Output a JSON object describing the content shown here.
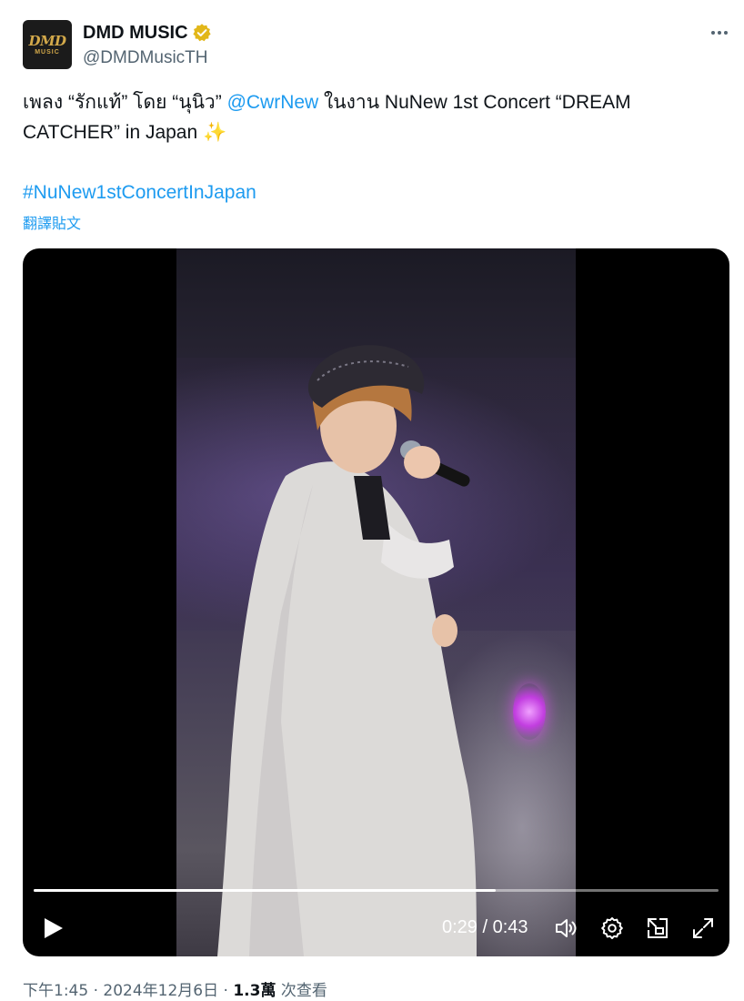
{
  "header": {
    "avatar_logo_main": "DMD",
    "avatar_logo_sub": "MUSIC",
    "display_name": "DMD MUSIC",
    "handle": "@DMDMusicTH",
    "verified_color": "#e2b719"
  },
  "tweet": {
    "text_part1": "เพลง “รักแท้” โดย “นุนิว” ",
    "mention": "@CwrNew",
    "text_part2": " ในงาน NuNew 1st Concert “DREAM CATCHER” in Japan ",
    "sparkle": "✨",
    "hashtag": "#NuNew1stConcertInJapan",
    "translate_label": "翻譯貼文"
  },
  "video": {
    "current_time": "0:29",
    "separator": " / ",
    "duration": "0:43",
    "progress_fraction": 0.674
  },
  "footer": {
    "time": "下午1:45",
    "dot1": " · ",
    "date": "2024年12月6日",
    "dot2": " · ",
    "views_count": "1.3萬",
    "views_label": " 次查看"
  },
  "colors": {
    "link": "#1d9bf0",
    "secondary_text": "#536471",
    "primary_text": "#0f1419"
  },
  "icons": {
    "verified": "verified-badge-icon",
    "more": "more-options-icon",
    "play": "play-icon",
    "volume": "volume-icon",
    "settings": "gear-icon",
    "pip": "picture-in-picture-icon",
    "fullscreen": "fullscreen-icon"
  }
}
